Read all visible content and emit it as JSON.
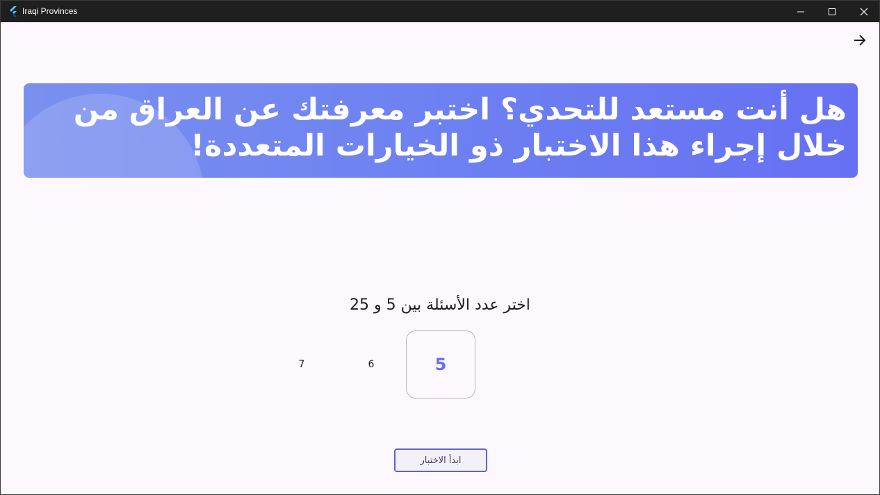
{
  "window": {
    "title": "Iraqi Provinces"
  },
  "banner": {
    "text": "هل أنت مستعد للتحدي؟ اختبر معرفتك عن العراق من خلال إجراء هذا الاختبار ذو الخيارات المتعددة!"
  },
  "quiz": {
    "prompt": "اختر عدد الأسئلة بين 5 و 25",
    "picker": {
      "selected": "5",
      "next1": "6",
      "next2": "7"
    },
    "start_label": "ابدأ الاختبار"
  },
  "icons": {
    "app": "flutter-icon",
    "forward": "arrow-right-icon"
  },
  "colors": {
    "accent": "#6670f3",
    "banner_start": "#7a90ef",
    "banner_end": "#6670f3",
    "background": "#fdf8fd"
  }
}
